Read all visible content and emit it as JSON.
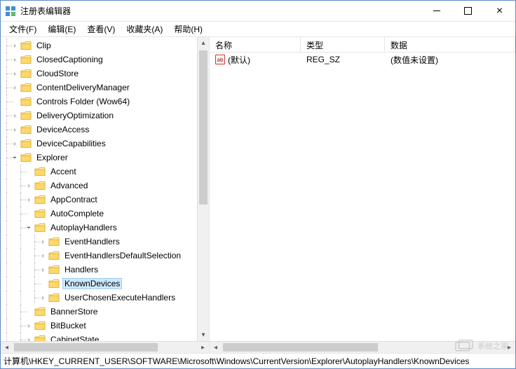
{
  "window": {
    "title": "注册表编辑器"
  },
  "menu": {
    "file": "文件(F)",
    "edit": "编辑(E)",
    "view": "查看(V)",
    "favorites": "收藏夹(A)",
    "help": "帮助(H)"
  },
  "tree": [
    {
      "depth": 1,
      "exp": "closed",
      "label": "Clip"
    },
    {
      "depth": 1,
      "exp": "closed",
      "label": "ClosedCaptioning"
    },
    {
      "depth": 1,
      "exp": "closed",
      "label": "CloudStore"
    },
    {
      "depth": 1,
      "exp": "closed",
      "label": "ContentDeliveryManager"
    },
    {
      "depth": 1,
      "exp": "none",
      "label": "Controls Folder (Wow64)"
    },
    {
      "depth": 1,
      "exp": "closed",
      "label": "DeliveryOptimization"
    },
    {
      "depth": 1,
      "exp": "closed",
      "label": "DeviceAccess"
    },
    {
      "depth": 1,
      "exp": "closed",
      "label": "DeviceCapabilities"
    },
    {
      "depth": 1,
      "exp": "open",
      "label": "Explorer"
    },
    {
      "depth": 2,
      "exp": "none",
      "label": "Accent"
    },
    {
      "depth": 2,
      "exp": "closed",
      "label": "Advanced"
    },
    {
      "depth": 2,
      "exp": "closed",
      "label": "AppContract"
    },
    {
      "depth": 2,
      "exp": "none",
      "label": "AutoComplete"
    },
    {
      "depth": 2,
      "exp": "open",
      "label": "AutoplayHandlers"
    },
    {
      "depth": 3,
      "exp": "closed",
      "label": "EventHandlers"
    },
    {
      "depth": 3,
      "exp": "closed",
      "label": "EventHandlersDefaultSelection"
    },
    {
      "depth": 3,
      "exp": "closed",
      "label": "Handlers"
    },
    {
      "depth": 3,
      "exp": "none",
      "label": "KnownDevices",
      "selected": true
    },
    {
      "depth": 3,
      "exp": "closed",
      "label": "UserChosenExecuteHandlers"
    },
    {
      "depth": 2,
      "exp": "none",
      "label": "BannerStore"
    },
    {
      "depth": 2,
      "exp": "closed",
      "label": "BitBucket"
    },
    {
      "depth": 2,
      "exp": "closed",
      "label": "CabinetState"
    }
  ],
  "list": {
    "columns": {
      "name": "名称",
      "type": "类型",
      "data": "数据"
    },
    "rows": [
      {
        "name": "(默认)",
        "type": "REG_SZ",
        "data": "(数值未设置)"
      }
    ]
  },
  "status": {
    "path": "计算机\\HKEY_CURRENT_USER\\SOFTWARE\\Microsoft\\Windows\\CurrentVersion\\Explorer\\AutoplayHandlers\\KnownDevices"
  },
  "watermark": {
    "text": "系统之家"
  }
}
